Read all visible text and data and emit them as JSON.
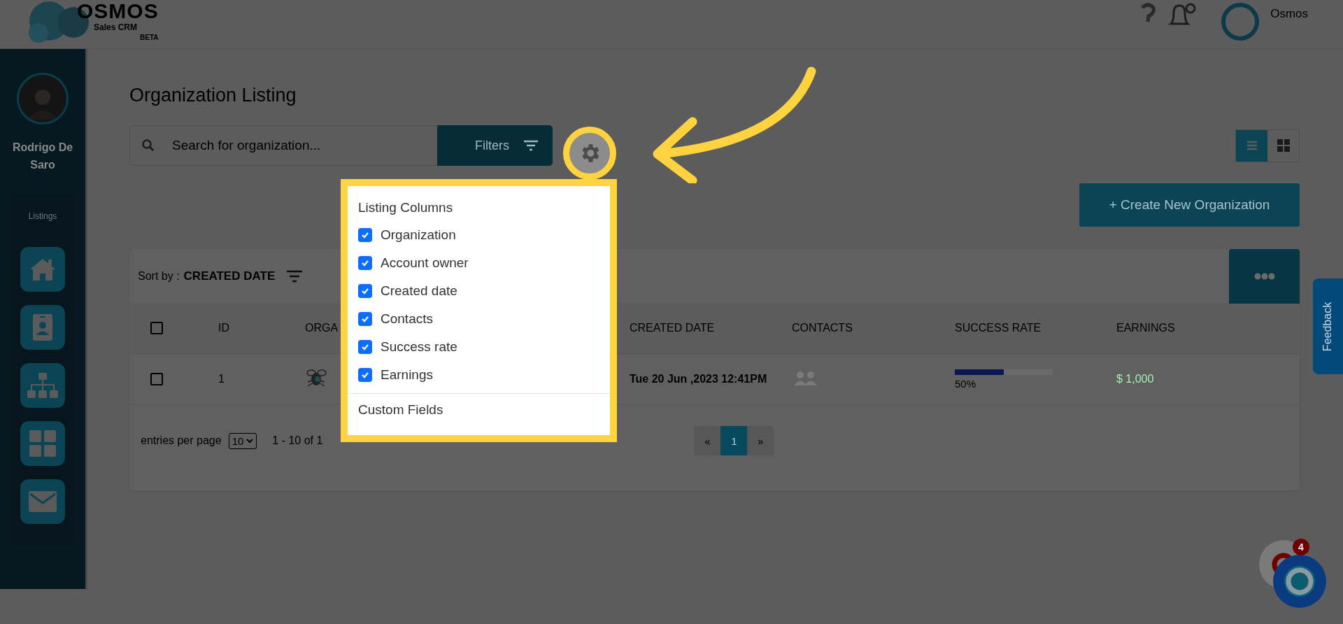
{
  "header": {
    "logo_title": "OSMOS",
    "logo_subtitle": "Sales CRM",
    "logo_badge": "BETA",
    "user_name": "Osmos"
  },
  "sidebar": {
    "user_name": "Rodrigo De Saro",
    "section_label": "Listings",
    "items": [
      {
        "kind": "home"
      },
      {
        "kind": "contact"
      },
      {
        "kind": "hierarchy"
      },
      {
        "kind": "grid"
      },
      {
        "kind": "mail"
      }
    ]
  },
  "page": {
    "title": "Organization Listing",
    "search_placeholder": "Search for organization...",
    "filters_label": "Filters",
    "create_button": "+ Create New Organization",
    "view_modes": [
      {
        "kind": "list",
        "selected": true
      },
      {
        "kind": "grid",
        "selected": false
      }
    ]
  },
  "sort": {
    "label": "Sort by :",
    "value": "CREATED DATE"
  },
  "table": {
    "select_all": {
      "checked": false
    },
    "columns": [
      "ID",
      "ORGA",
      "CREATED DATE",
      "CONTACTS",
      "SUCCESS RATE",
      "EARNINGS"
    ],
    "rows": [
      {
        "checked": false,
        "id": "1",
        "created_date": "Tue 20 Jun ,2023 12:41PM",
        "level": 0.5,
        "success_rate": "50%",
        "earnings": "$ 1,000"
      }
    ]
  },
  "pagination": {
    "entries_label": "entries per page",
    "per_page": "10",
    "range": "1 - 10 of 1",
    "pages": [
      {
        "label": "«",
        "selected": false
      },
      {
        "label": "1",
        "selected": true
      },
      {
        "label": "»",
        "selected": false
      }
    ]
  },
  "columns_menu": {
    "title": "Listing Columns",
    "options": [
      {
        "label": "Organization",
        "checked": true
      },
      {
        "label": "Account owner",
        "checked": true
      },
      {
        "label": "Created date",
        "checked": true
      },
      {
        "label": "Contacts",
        "checked": true
      },
      {
        "label": "Success rate",
        "checked": true
      },
      {
        "label": "Earnings",
        "checked": true
      }
    ],
    "footer": "Custom Fields"
  },
  "feedback": {
    "label": "Feedback"
  },
  "chat": {
    "badge": "4"
  }
}
